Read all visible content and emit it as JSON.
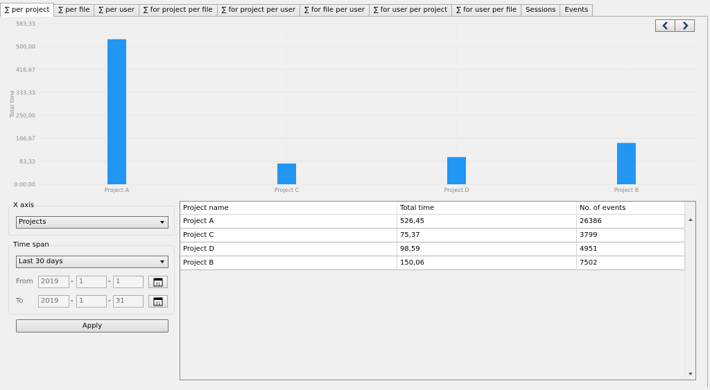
{
  "tabs": [
    {
      "label": "∑ per project",
      "active": true
    },
    {
      "label": "∑ per file",
      "active": false
    },
    {
      "label": "∑ per user",
      "active": false
    },
    {
      "label": "∑ for project per file",
      "active": false
    },
    {
      "label": "∑ for project per user",
      "active": false
    },
    {
      "label": "∑ for file per user",
      "active": false
    },
    {
      "label": "∑ for user per project",
      "active": false
    },
    {
      "label": "∑ for user per file",
      "active": false
    },
    {
      "label": "Sessions",
      "active": false
    },
    {
      "label": "Events",
      "active": false
    }
  ],
  "chart_data": {
    "type": "bar",
    "ylabel": "Total time",
    "xlabel": "",
    "categories": [
      "Project A",
      "Project C",
      "Project D",
      "Project B"
    ],
    "values": [
      526.45,
      75.37,
      98.59,
      150.06
    ],
    "ylim": [
      0,
      583.33
    ],
    "yticks": [
      "0:00:00",
      "83,33",
      "166,67",
      "250,00",
      "333,33",
      "416,67",
      "500,00",
      "583,33"
    ],
    "ytick_values": [
      0,
      83.33,
      166.67,
      250,
      333.33,
      416.67,
      500,
      583.33
    ],
    "bar_color": "#2196f3",
    "grid": true
  },
  "x_axis": {
    "group_label": "X axis",
    "selected": "Projects"
  },
  "time_span": {
    "group_label": "Time span",
    "selected": "Last 30 days",
    "from_label": "From",
    "to_label": "To",
    "from": {
      "year": "2019",
      "month": "1",
      "day": "1"
    },
    "to": {
      "year": "2019",
      "month": "1",
      "day": "31"
    },
    "separator": "-"
  },
  "apply_label": "Apply",
  "table": {
    "columns": [
      "Project name",
      "Total time",
      "No. of events"
    ],
    "rows": [
      [
        "Project A",
        "526,45",
        "26386"
      ],
      [
        "Project C",
        "75,37",
        "3799"
      ],
      [
        "Project D",
        "98,59",
        "4951"
      ],
      [
        "Project B",
        "150,06",
        "7502"
      ]
    ]
  },
  "icons": {
    "prev": "chevron-left-icon",
    "next": "chevron-right-icon",
    "calendar_day": "31"
  }
}
